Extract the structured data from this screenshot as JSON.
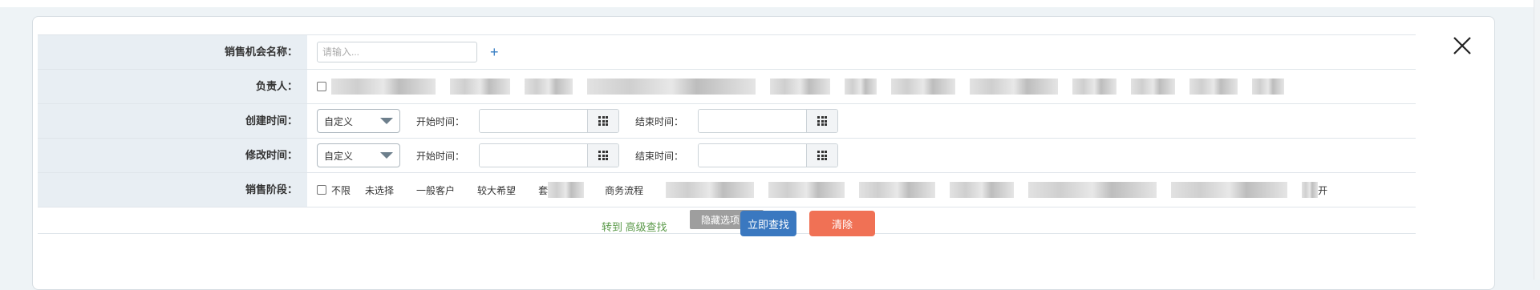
{
  "colors": {
    "accent_blue": "#3a78c0",
    "danger_red": "#f07155",
    "link_green": "#5b9a4a",
    "label_bg": "#e8eef3"
  },
  "form": {
    "name_row": {
      "label": "销售机会名称：",
      "placeholder": "请输入...",
      "add_icon": "plus-icon"
    },
    "owner_row": {
      "label": "负责人："
    },
    "created_row": {
      "label": "创建时间：",
      "select_value": "自定义",
      "start_label": "开始时间：",
      "end_label": "结束时间："
    },
    "modified_row": {
      "label": "修改时间：",
      "select_value": "自定义",
      "start_label": "开始时间：",
      "end_label": "结束时间："
    },
    "stage_row": {
      "label": "销售阶段：",
      "options": [
        "不限",
        "未选择",
        "一般客户",
        "较大希望",
        "套",
        "商务流程",
        "开"
      ]
    }
  },
  "toggle": {
    "label": "隐藏选项"
  },
  "actions": {
    "advanced_link": "转到 高级查找",
    "search_button": "立即查找",
    "clear_button": "清除"
  },
  "icons": {
    "close": "close-icon",
    "calendar": "calendar-grid-icon",
    "dropdown": "chevron-down-icon",
    "collapse": "chevron-up-icon"
  }
}
